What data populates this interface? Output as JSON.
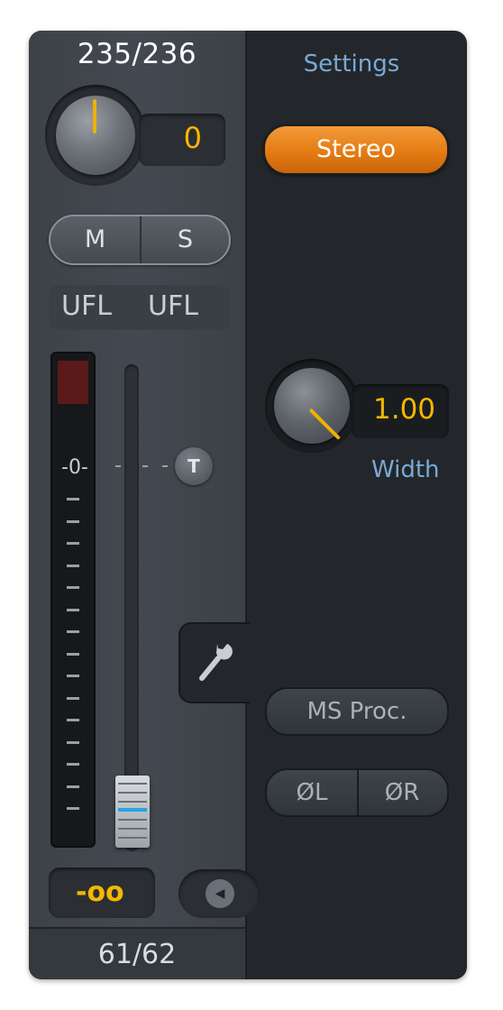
{
  "strip": {
    "title": "235/236",
    "gain_value": "0",
    "mute_label": "M",
    "solo_label": "S",
    "level_left": "UFL",
    "level_right": "UFL",
    "meter_zero_label": "-0-",
    "talkback_label": "T",
    "fader_value": "-oo",
    "footer": "61/62"
  },
  "settings": {
    "title": "Settings",
    "mode_label": "Stereo",
    "width_value": "1.00",
    "width_label": "Width",
    "ms_proc_label": "MS Proc.",
    "phase_left_label": "ØL",
    "phase_right_label": "ØR"
  },
  "colors": {
    "accent_orange": "#e47c12",
    "value_yellow": "#f4b800",
    "label_blue": "#7aa9d6",
    "fader_blue": "#2aa3e4"
  },
  "icons": [
    "gain-knob",
    "width-knob",
    "wrench-icon",
    "arrow-left-icon"
  ]
}
